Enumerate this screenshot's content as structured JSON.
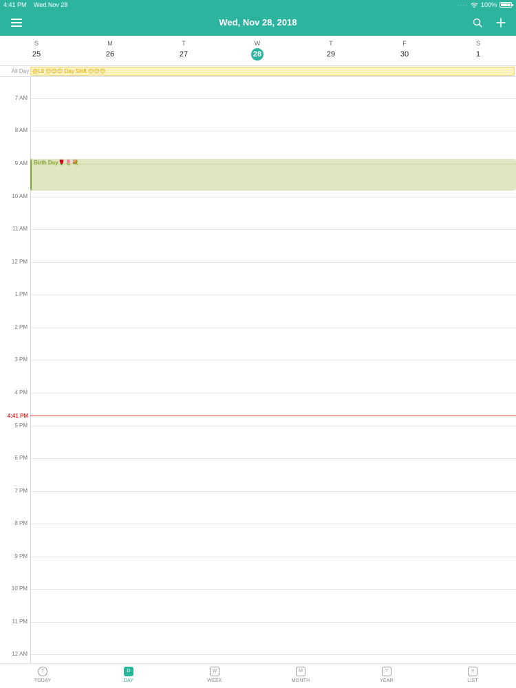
{
  "status_bar": {
    "time": "4:41 PM",
    "date": "Wed Nov 28",
    "battery": "100%"
  },
  "navbar": {
    "title": "Wed, Nov 28, 2018",
    "menu_icon": "hamburger-menu-icon",
    "search_icon": "search-icon",
    "add_icon": "plus-icon"
  },
  "week": {
    "days": [
      {
        "letter": "S",
        "num": "25"
      },
      {
        "letter": "M",
        "num": "26"
      },
      {
        "letter": "T",
        "num": "27"
      },
      {
        "letter": "W",
        "num": "28"
      },
      {
        "letter": "T",
        "num": "29"
      },
      {
        "letter": "F",
        "num": "30"
      },
      {
        "letter": "S",
        "num": "1"
      }
    ]
  },
  "all_day": {
    "label": "All Day",
    "event": "@L8 😊😊😊 Day  Shift 😊😊😊"
  },
  "hours": [
    "7 AM",
    "8 AM",
    "9 AM",
    "10 AM",
    "11 AM",
    "12 PM",
    "1 PM",
    "2 PM",
    "3 PM",
    "4 PM",
    "5 PM",
    "6 PM",
    "7 PM",
    "8 PM",
    "9 PM",
    "10 PM",
    "11 PM",
    "12 AM"
  ],
  "event": {
    "title": "Birth Day🌹🌷💐",
    "color": "#dfe6c1"
  },
  "now": {
    "label": "4:41 PM",
    "color": "#e2342b"
  },
  "tabs": [
    {
      "icon": "T",
      "label": "TODAY"
    },
    {
      "icon": "D",
      "label": "DAY"
    },
    {
      "icon": "W",
      "label": "WEEK"
    },
    {
      "icon": "M",
      "label": "MONTH"
    },
    {
      "icon": "Y",
      "label": "YEAR"
    },
    {
      "icon": "≡",
      "label": "LIST"
    }
  ],
  "colors": {
    "accent": "#2db49f",
    "allday_bg": "#fff3c0",
    "now_line": "#e2342b"
  }
}
